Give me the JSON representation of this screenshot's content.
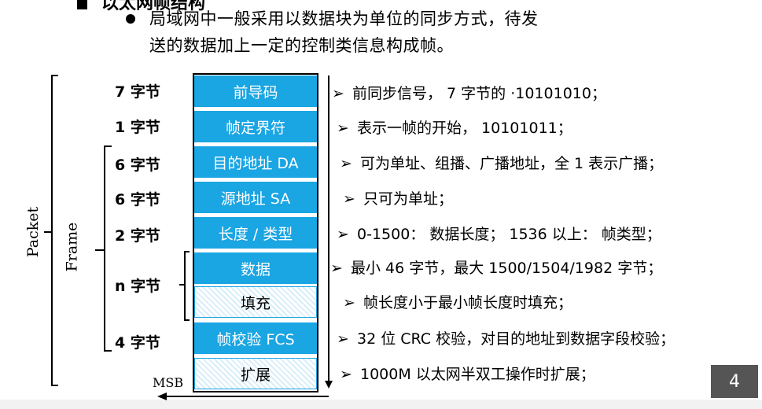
{
  "heading": "以太网帧结构",
  "bullet_lines": [
    "局域网中一般采用以数据块为单位的同步方式，待发",
    "送的数据加上一定的控制类信息构成帧。"
  ],
  "left_labels": {
    "packet": "Packet",
    "frame": "Frame",
    "msb": "MSB"
  },
  "rows": [
    {
      "bytes": "7 字节",
      "field": "前导码",
      "style": "blue",
      "desc": "前同步信号， 7 字节的 ·10101010；"
    },
    {
      "bytes": "1 字节",
      "field": "帧定界符",
      "style": "blue",
      "desc": "表示一帧的开始， 10101011；"
    },
    {
      "bytes": "6 字节",
      "field": "目的地址 DA",
      "style": "blue",
      "desc": "可为单址、组播、广播地址，全 1 表示广播；"
    },
    {
      "bytes": "6 字节",
      "field": "源地址 SA",
      "style": "blue",
      "desc": "只可为单址；"
    },
    {
      "bytes": "2 字节",
      "field": "长度 / 类型",
      "style": "blue",
      "desc": "0-1500： 数据长度； 1536 以上： 帧类型；"
    },
    {
      "bytes": "n 字节",
      "field": "数据",
      "style": "blue",
      "desc": "最小 46 字节，最大 1500/1504/1982 字节；"
    },
    {
      "bytes": "",
      "field": "填充",
      "style": "hatch",
      "desc": "帧长度小于最小帧长度时填充；"
    },
    {
      "bytes": "4 字节",
      "field": "帧校验 FCS",
      "style": "blue",
      "desc": "32 位 CRC 校验，对目的地址到数据字段校验；"
    },
    {
      "bytes": "",
      "field": "扩展",
      "style": "hatch",
      "desc": "1000M 以太网半双工操作时扩展；"
    }
  ],
  "bullet_arrow": "➢",
  "page_number": "4",
  "colors": {
    "field_blue": "#1aa5e3",
    "page_badge": "#555555"
  }
}
